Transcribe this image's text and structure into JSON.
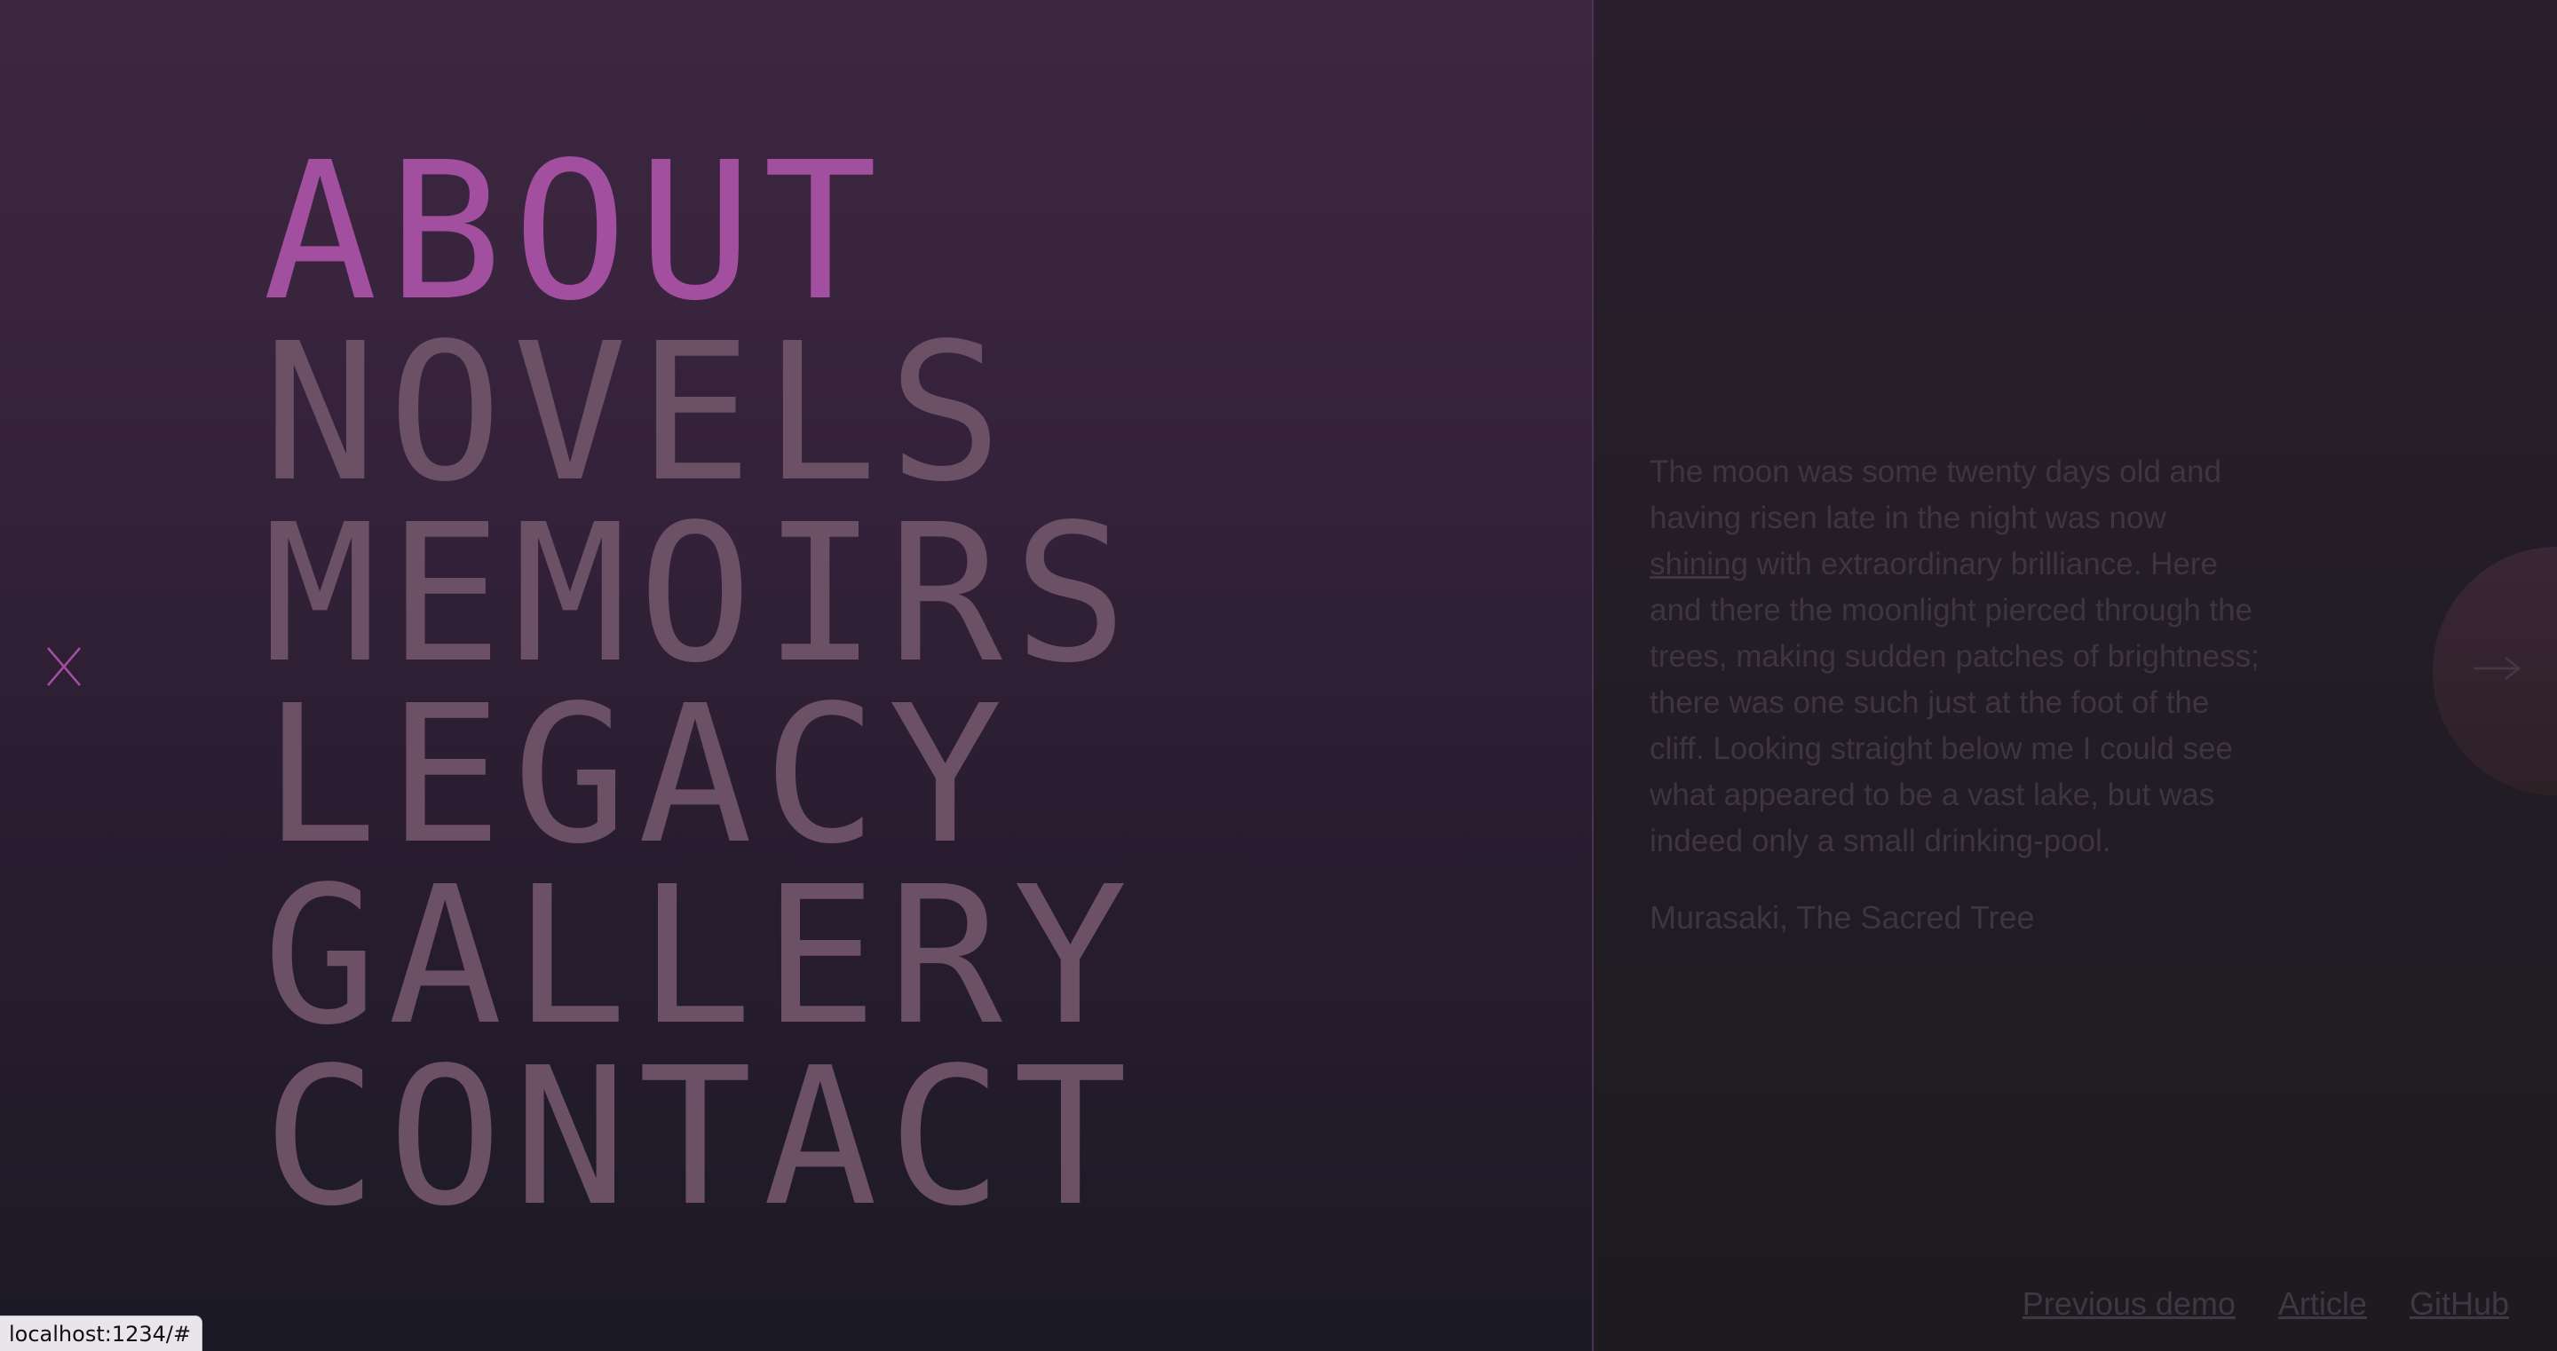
{
  "menu": {
    "items": [
      {
        "label": "ABOUT",
        "active": true
      },
      {
        "label": "NOVELS",
        "active": false
      },
      {
        "label": "MEMOIRS",
        "active": false
      },
      {
        "label": "LEGACY",
        "active": false
      },
      {
        "label": "GALLERY",
        "active": false
      },
      {
        "label": "CONTACT",
        "active": false
      }
    ],
    "close_icon": "close-x-icon"
  },
  "quote": {
    "text_before_link": "The moon was some twenty days old and having risen late in the night was now ",
    "link_text": "shining",
    "text_after_link": " with extraordinary brilliance. Here and there the moonlight pierced through the trees, making sudden patches of brightness; there was one such just at the foot of the cliff. Looking straight below me I could see what appeared to be a vast lake, but was indeed only a small drinking-pool.",
    "attribution": "Murasaki, The Sacred Tree"
  },
  "next_button": {
    "icon": "arrow-right-icon"
  },
  "footer": {
    "links": [
      "Previous demo",
      "Article",
      "GitHub"
    ]
  },
  "status_bar": {
    "url": "localhost:1234/#"
  },
  "colors": {
    "accent": "#a24fa0",
    "menu_text": "#6b5066",
    "muted_text": "#3e3541"
  }
}
